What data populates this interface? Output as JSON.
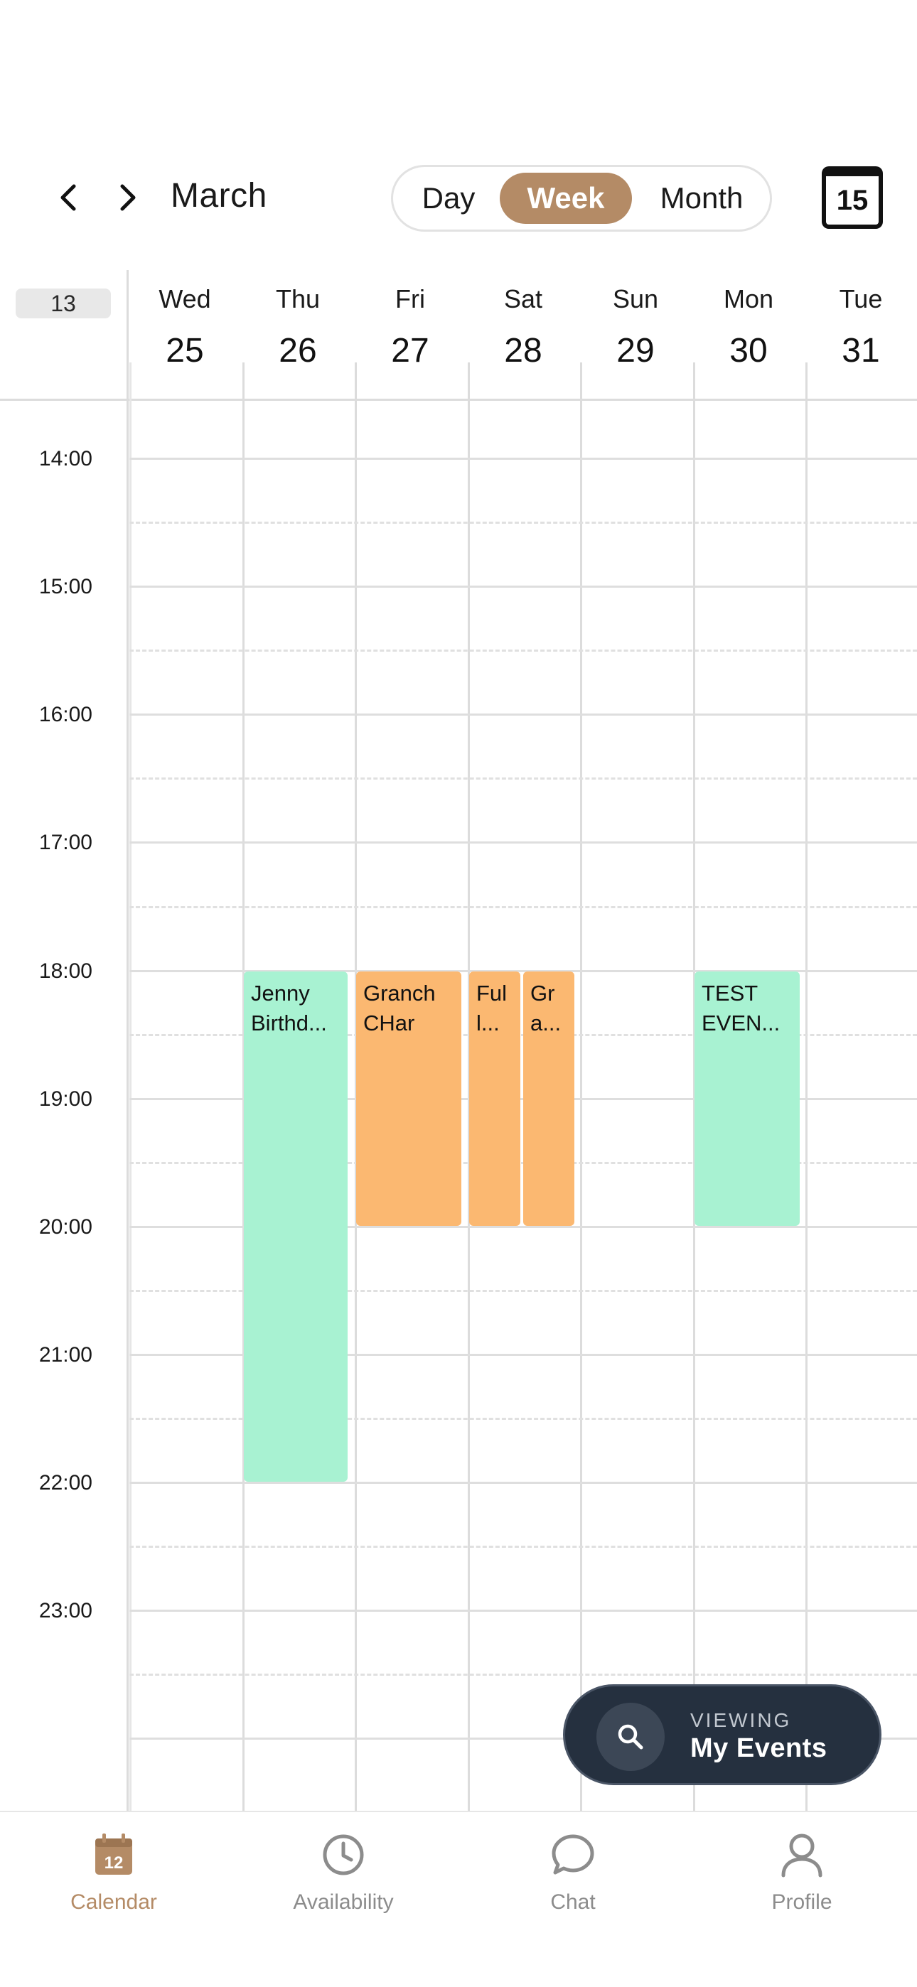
{
  "header": {
    "month": "March",
    "view_options": [
      "Day",
      "Week",
      "Month"
    ],
    "active_view": "Week",
    "today_number": "15"
  },
  "week_number": "13",
  "days": [
    {
      "name": "Wed",
      "num": "25"
    },
    {
      "name": "Thu",
      "num": "26"
    },
    {
      "name": "Fri",
      "num": "27"
    },
    {
      "name": "Sat",
      "num": "28"
    },
    {
      "name": "Sun",
      "num": "29"
    },
    {
      "name": "Mon",
      "num": "30"
    },
    {
      "name": "Tue",
      "num": "31"
    }
  ],
  "hours": [
    "14:00",
    "15:00",
    "16:00",
    "17:00",
    "18:00",
    "19:00",
    "20:00",
    "21:00",
    "22:00",
    "23:00"
  ],
  "events": [
    {
      "lines": [
        "Jenny",
        "Birthd..."
      ],
      "day": "Thu",
      "start": "18:00",
      "end": "22:00",
      "color": "#a8f2d2"
    },
    {
      "lines": [
        "Granch",
        "CHar"
      ],
      "day": "Fri",
      "start": "18:00",
      "end": "20:00",
      "color": "#fbb871"
    },
    {
      "lines": [
        "Ful",
        "l..."
      ],
      "day": "Sat",
      "start": "18:00",
      "end": "20:00",
      "color": "#fbb871"
    },
    {
      "lines": [
        "Gr",
        "a..."
      ],
      "day": "Sat",
      "start": "18:00",
      "end": "20:00",
      "color": "#fbb871"
    },
    {
      "lines": [
        "TEST",
        "EVEN..."
      ],
      "day": "Mon",
      "start": "18:00",
      "end": "20:00",
      "color": "#a8f2d2"
    }
  ],
  "viewing": {
    "label": "VIEWING",
    "value": "My Events",
    "icon": "search-icon"
  },
  "tabs": [
    {
      "label": "Calendar",
      "icon": "calendar-icon",
      "icon_text": "12",
      "active": true
    },
    {
      "label": "Availability",
      "icon": "clock-icon",
      "active": false
    },
    {
      "label": "Chat",
      "icon": "chat-bubble-icon",
      "active": false
    },
    {
      "label": "Profile",
      "icon": "person-icon",
      "active": false
    }
  ],
  "colors": {
    "accent": "#b48b66",
    "event_green": "#a8f2d2",
    "event_orange": "#fbb871",
    "fab_background": "#25303f",
    "tab_inactive": "#8c8c8c"
  }
}
